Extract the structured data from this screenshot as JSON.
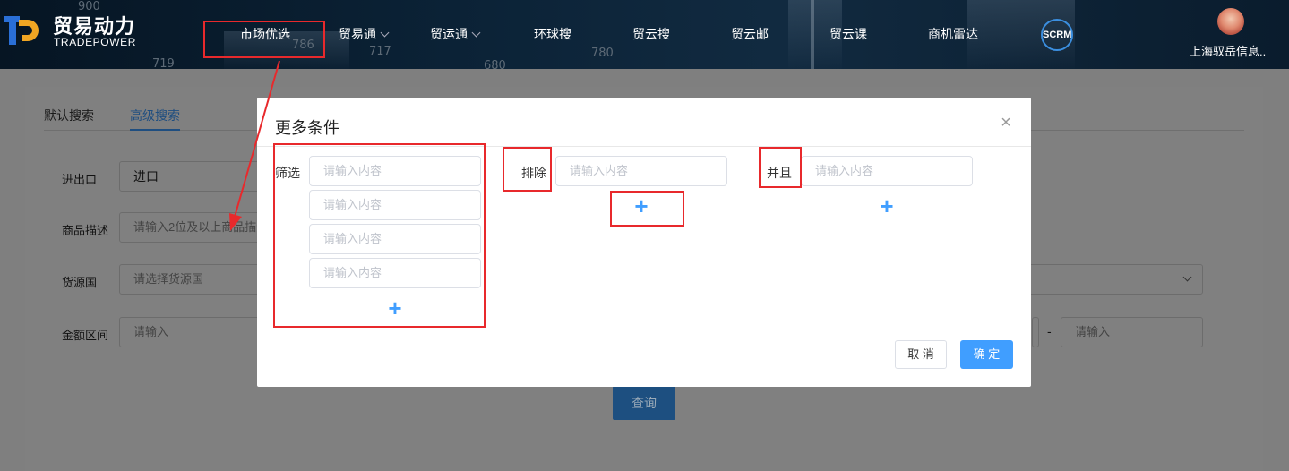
{
  "header": {
    "logo_cn": "贸易动力",
    "logo_en": "TRADEPOWER",
    "bg_numbers": [
      "900",
      "719",
      "786",
      "717",
      "680",
      "780"
    ],
    "nav": [
      {
        "label": "市场优选",
        "has_dropdown": false
      },
      {
        "label": "贸易通",
        "has_dropdown": true
      },
      {
        "label": "贸运通",
        "has_dropdown": true
      },
      {
        "label": "环球搜",
        "has_dropdown": false
      },
      {
        "label": "贸云搜",
        "has_dropdown": false
      },
      {
        "label": "贸云邮",
        "has_dropdown": false
      },
      {
        "label": "贸云课",
        "has_dropdown": false
      },
      {
        "label": "商机雷达",
        "has_dropdown": false
      }
    ],
    "scrm_label": "SCRM",
    "user_name": "上海驭岳信息.."
  },
  "search_page": {
    "tabs": [
      {
        "label": "默认搜索",
        "active": false
      },
      {
        "label": "高级搜索",
        "active": true
      }
    ],
    "fields": {
      "trade_direction": {
        "label": "进出口",
        "value": "进口"
      },
      "product_desc": {
        "label": "商品描述",
        "placeholder": "请输入2位及以上商品描述"
      },
      "origin_country": {
        "label": "货源国",
        "placeholder": "请选择货源国"
      },
      "amount_range": {
        "label": "金额区间",
        "placeholder_from": "请输入",
        "separator": "-",
        "placeholder_to": "请输入"
      }
    },
    "query_button": "查询"
  },
  "modal": {
    "title": "更多条件",
    "close_icon": "close-icon",
    "filter": {
      "label": "筛选",
      "inputs": [
        "请输入内容",
        "请输入内容",
        "请输入内容",
        "请输入内容"
      ]
    },
    "exclude": {
      "label": "排除",
      "inputs": [
        "请输入内容"
      ]
    },
    "and": {
      "label": "并且",
      "inputs": [
        "请输入内容"
      ]
    },
    "add_icon": "+",
    "cancel_label": "取 消",
    "confirm_label": "确 定"
  },
  "colors": {
    "accent": "#409eff",
    "annotation": "#e8292c",
    "header_bg": "#0b2236",
    "overlay": "#7f7f7f"
  }
}
